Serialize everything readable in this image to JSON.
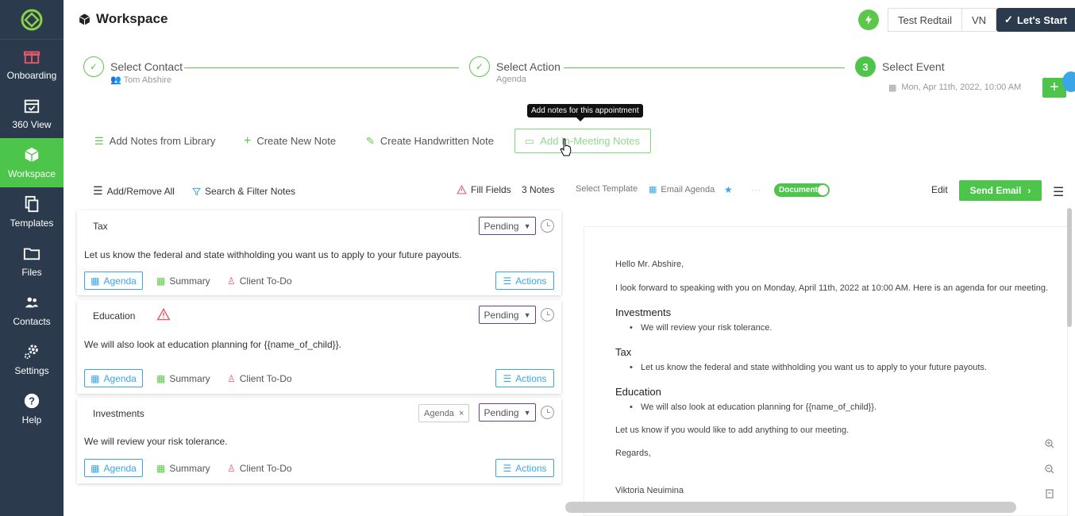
{
  "sidebar": {
    "items": [
      {
        "label": "Onboarding",
        "icon": "gift-icon"
      },
      {
        "label": "360 View",
        "icon": "calendar-check-icon"
      },
      {
        "label": "Workspace",
        "icon": "cube-icon",
        "active": true
      },
      {
        "label": "Templates",
        "icon": "templates-icon"
      },
      {
        "label": "Files",
        "icon": "folder-icon"
      },
      {
        "label": "Contacts",
        "icon": "contacts-icon"
      },
      {
        "label": "Settings",
        "icon": "gear-icon"
      },
      {
        "label": "Help",
        "icon": "help-icon"
      }
    ]
  },
  "header": {
    "title": "Workspace",
    "user_button": "Test Redtail",
    "lang_button": "VN",
    "start_button": "Let's Start"
  },
  "stepper": {
    "steps": [
      {
        "label": "Select Contact",
        "sub": "Tom Abshire"
      },
      {
        "label": "Select Action",
        "sub": "Agenda"
      },
      {
        "label": "Select Event",
        "sub": "Mon, Apr 11th, 2022, 10:00 AM",
        "number": "3"
      }
    ]
  },
  "tooltip": "Add notes for this appointment",
  "note_actions": {
    "library": "Add Notes from Library",
    "create": "Create New Note",
    "handwritten": "Create Handwritten Note",
    "in_meeting": "Add In-Meeting Notes"
  },
  "toolbar": {
    "add_remove": "Add/Remove All",
    "search_filter": "Search & Filter Notes",
    "fill_fields": "Fill Fields",
    "notes_count": "3 Notes",
    "select_template": "Select Template",
    "template_name": "Email Agenda",
    "toggle_label": "Document",
    "edit": "Edit",
    "send_email": "Send Email"
  },
  "notes": [
    {
      "title": "Tax",
      "body": "Let us know the federal and state withholding you want us to apply to your future payouts.",
      "status": "Pending"
    },
    {
      "title": "Education",
      "body": "We will also look at education planning for {{name_of_child}}.",
      "status": "Pending",
      "warning": true
    },
    {
      "title": "Investments",
      "body": "We will review your risk tolerance.",
      "status": "Pending",
      "chip": "Agenda"
    }
  ],
  "note_tags": {
    "agenda": "Agenda",
    "summary": "Summary",
    "todo": "Client To-Do",
    "actions": "Actions"
  },
  "document": {
    "greeting": "Hello Mr. Abshire,",
    "intro": "I look forward to speaking with you on Monday, April 11th, 2022 at 10:00 AM. Here is an agenda for our meeting.",
    "sections": [
      {
        "heading": "Investments",
        "item": "We will review your risk tolerance."
      },
      {
        "heading": "Tax",
        "item": "Let us know the federal and state withholding you want us to apply to your future payouts."
      },
      {
        "heading": "Education",
        "item": "We will also look at education planning for {{name_of_child}}."
      }
    ],
    "closing": "Let us know if you would like to add anything to our meeting.",
    "regards": "Regards,",
    "signature": "Viktoria Neuimina"
  },
  "colors": {
    "sidebar": "#2b3a4c",
    "accent_green": "#4cc54a",
    "accent_blue": "#3aa6e8",
    "status_border": "#6b3f8a"
  }
}
